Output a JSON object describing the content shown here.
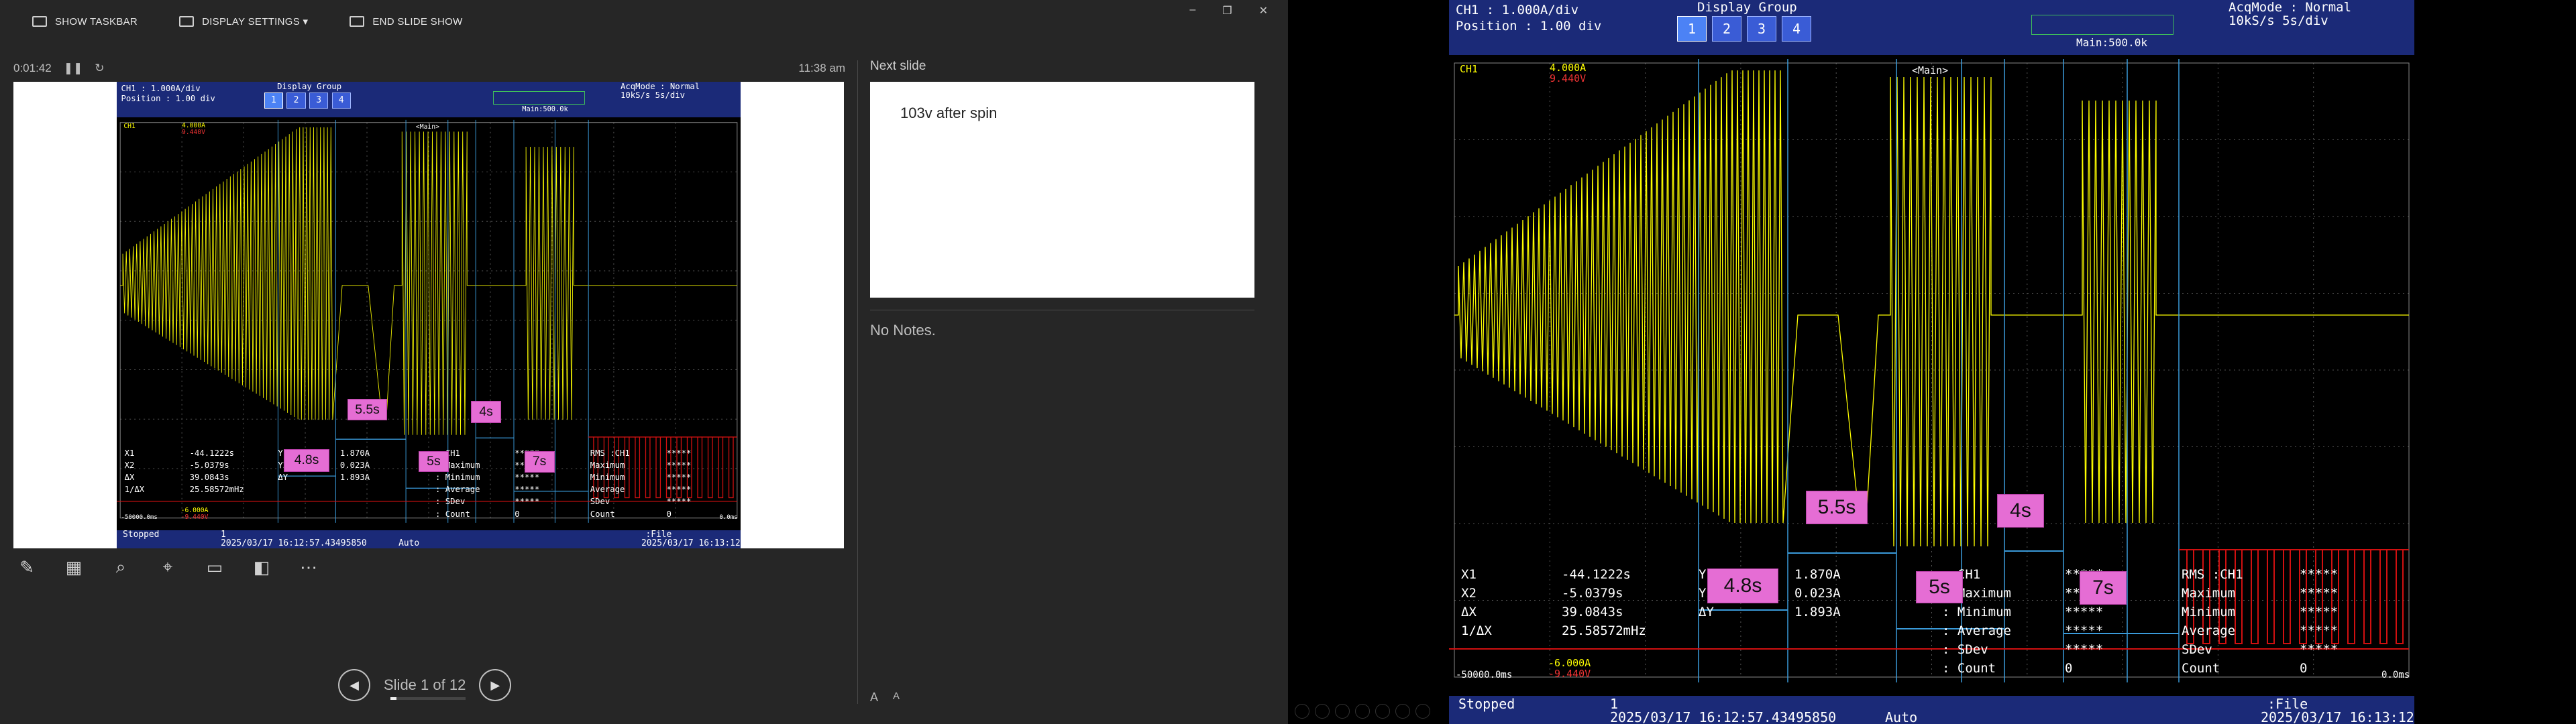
{
  "toolbar": {
    "show_taskbar": "SHOW TASKBAR",
    "display_settings": "DISPLAY SETTINGS ▾",
    "end_slide_show": "END SLIDE SHOW"
  },
  "window_controls": {
    "minimize": "–",
    "restore": "❐",
    "close": "✕"
  },
  "presenter": {
    "elapsed": "0:01:42",
    "pause_icon": "pause-icon",
    "restart_icon": "restart-icon",
    "clock": "11:38 am",
    "next_slide_label": "Next slide",
    "next_slide_text": "103v after spin",
    "notes": "No Notes.",
    "slide_counter": "Slide 1 of 12",
    "progress_fraction": 0.083,
    "tools": [
      "pen-icon",
      "slides-grid-icon",
      "zoom-icon",
      "laser-pointer-icon",
      "black-screen-icon",
      "camera-icon",
      "more-options-icon"
    ],
    "font_increase": "A",
    "font_decrease": "A"
  },
  "scope": {
    "ch1_line": "CH1   : 1.000A/div",
    "position_line": "Position : 1.00 div",
    "display_group_title": "Display Group",
    "display_group_buttons": [
      "1",
      "2",
      "3",
      "4"
    ],
    "display_group_active": "1",
    "main_label": "Main:500.0k",
    "acq_line1": "AcqMode : Normal",
    "acq_line2": "10kS/s    5s/div",
    "ch1_marker": "CH1",
    "ch_scale": "4.000A",
    "ch_offset": "9.440V",
    "main_tag": "<Main>",
    "cursor_rows": [
      {
        "name": "X1",
        "value": "-44.1222s"
      },
      {
        "name": "X2",
        "value": "-5.0379s"
      },
      {
        "name": "ΔX",
        "value": "39.0843s"
      },
      {
        "name": "1/ΔX",
        "value": "25.58572mHz"
      }
    ],
    "y_rows": [
      {
        "name": "Y1",
        "value": "1.870A"
      },
      {
        "name": "Y2",
        "value": "0.023A"
      },
      {
        "name": "ΔY",
        "value": "1.893A"
      }
    ],
    "stats_col1": [
      ": CH1",
      ": Maximum",
      ": Minimum",
      ": Average",
      ": SDev",
      ": Count"
    ],
    "stats_col1_vals": [
      "*****",
      "*****",
      "*****",
      "*****",
      "*****",
      "0"
    ],
    "stats_col2": [
      "RMS  :CH1",
      "Maximum",
      "Minimum",
      "Average",
      "SDev",
      "Count"
    ],
    "stats_col2_vals": [
      "*****",
      "*****",
      "*****",
      "*****",
      "*****",
      "0"
    ],
    "bottom_left_scale": "-6.000A",
    "bottom_left_offset": "-9.440V",
    "time_left": "-50000.0ms",
    "time_right": "0.0ms",
    "status": "Stopped",
    "record_no": "1",
    "timestamp_left": "2025/03/17 16:12:57.43495850",
    "trigger_mode": "Auto",
    "file_label": ":File",
    "timestamp_right": "2025/03/17 16:13:12",
    "annotations": [
      "5.5s",
      "4s",
      "4.8s",
      "5s",
      "7s"
    ]
  },
  "colors": {
    "trace": "#ffff00",
    "scope_header": "#1b2a78",
    "annotation_bg": "#e56dd4",
    "cursor_line": "#3a9ad9",
    "red_trace": "#d11010"
  }
}
